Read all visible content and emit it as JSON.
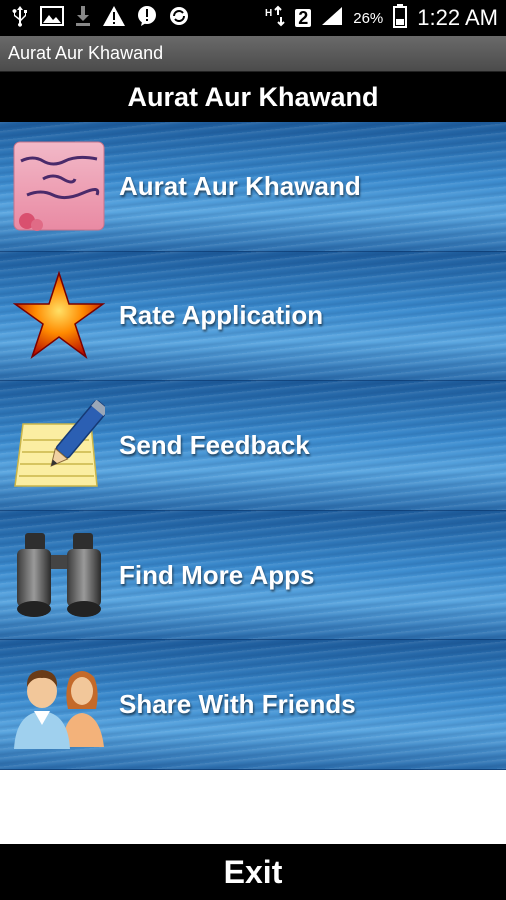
{
  "status_bar": {
    "icons": [
      "usb-icon",
      "image-icon",
      "download-icon",
      "warning-icon",
      "alert-icon",
      "sync-icon",
      "data-icon",
      "sim-2-icon",
      "signal-icon",
      "battery-icon"
    ],
    "sim_label": "2",
    "battery_percent": "26%",
    "time": "1:22 AM"
  },
  "app_title": "Aurat Aur Khawand",
  "header": {
    "title": "Aurat Aur Khawand"
  },
  "menu": {
    "items": [
      {
        "label": "Aurat Aur Khawand",
        "icon": "book-cover-icon"
      },
      {
        "label": "Rate Application",
        "icon": "star-icon"
      },
      {
        "label": "Send Feedback",
        "icon": "notepad-pencil-icon"
      },
      {
        "label": "Find More Apps",
        "icon": "binoculars-icon"
      },
      {
        "label": "Share With Friends",
        "icon": "people-icon"
      }
    ]
  },
  "exit": {
    "label": "Exit"
  },
  "colors": {
    "menu_blue": "#3c8ccf",
    "bar_black": "#000000",
    "title_bar_gray": "#5a5a5a"
  }
}
